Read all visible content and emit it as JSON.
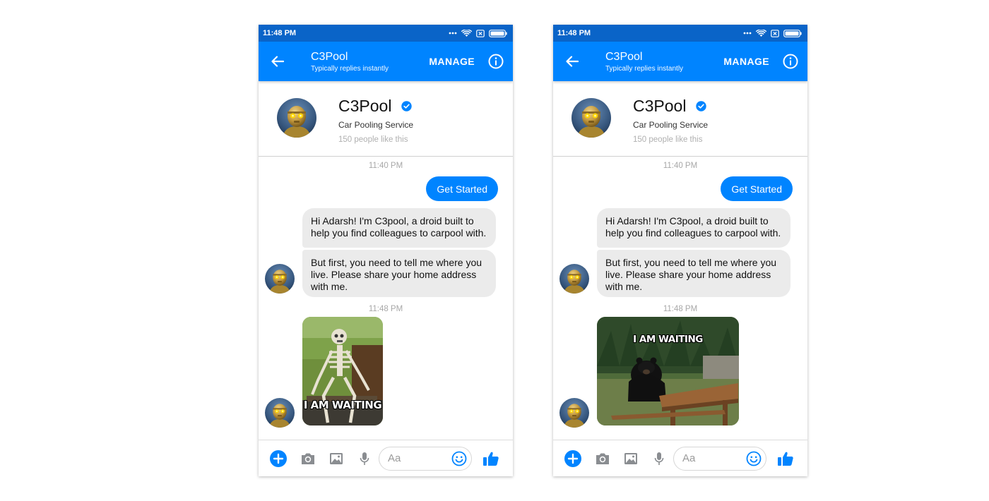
{
  "screens": [
    {
      "status_time": "11:48 PM",
      "header": {
        "title": "C3Pool",
        "subtitle": "Typically replies instantly",
        "manage_label": "MANAGE"
      },
      "profile": {
        "name": "C3Pool",
        "category": "Car Pooling Service",
        "likes": "150 people like this"
      },
      "messages": {
        "timestamp_1": "11:40 PM",
        "user_button": "Get Started",
        "bot_1": "Hi Adarsh! I'm C3pool, a droid built to help you find colleagues to carpool with.",
        "bot_2": "But first, you need to tell me where you live. Please share your home address with me.",
        "timestamp_2": "11:48 PM",
        "meme_caption": "I AM WAITING"
      },
      "composer": {
        "placeholder": "Aa"
      }
    },
    {
      "status_time": "11:48 PM",
      "header": {
        "title": "C3Pool",
        "subtitle": "Typically replies instantly",
        "manage_label": "MANAGE"
      },
      "profile": {
        "name": "C3Pool",
        "category": "Car Pooling Service",
        "likes": "150 people like this"
      },
      "messages": {
        "timestamp_1": "11:40 PM",
        "user_button": "Get Started",
        "bot_1": "Hi Adarsh! I'm C3pool, a droid built to help you find colleagues to carpool with.",
        "bot_2": "But first, you need to tell me where you live. Please share your home address with me.",
        "timestamp_2": "11:48 PM",
        "meme_caption": "I AM WAITING"
      },
      "composer": {
        "placeholder": "Aa"
      }
    }
  ],
  "icons": {
    "back": "arrow-left-icon",
    "info": "info-icon",
    "verified": "verified-check-icon",
    "plus": "plus-icon",
    "camera": "camera-icon",
    "image": "image-icon",
    "mic": "microphone-icon",
    "emoji": "emoji-icon",
    "like": "thumbs-up-icon"
  },
  "colors": {
    "messenger_blue": "#0084ff",
    "status_bar": "#0a64c8",
    "bubble_gray": "#ebebeb"
  }
}
